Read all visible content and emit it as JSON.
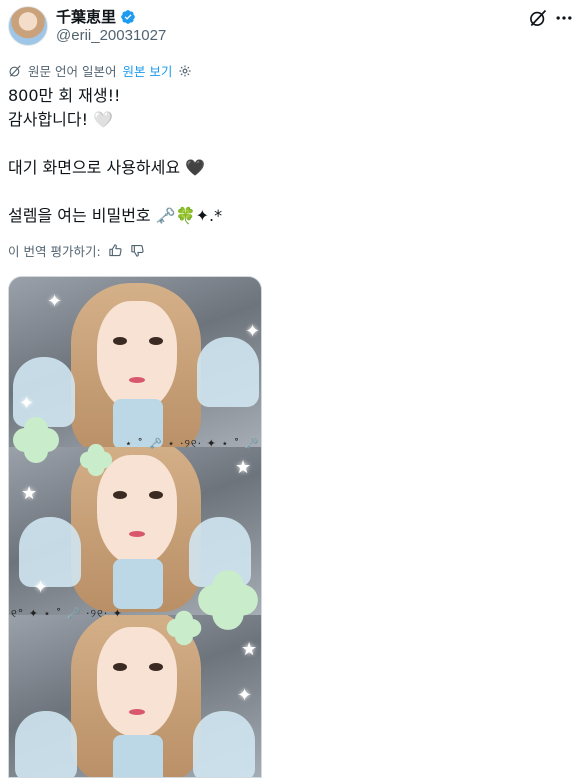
{
  "author": {
    "display_name": "千葉恵里",
    "handle": "@erii_20031027",
    "verified_icon": "verified-badge-icon",
    "accent_color": "#1d9bf0"
  },
  "header_actions": {
    "grok_icon": "grok-icon",
    "more_icon": "more-icon"
  },
  "translation": {
    "icon": "translate-icon",
    "source_label": "원문 언어 일본어",
    "show_original_label": "원본 보기",
    "settings_icon": "gear-icon"
  },
  "tweet": {
    "text": "800만 회 재생!!\n감사합니다! 🤍\n\n대기 화면으로 사용하세요 🖤\n\n설렘을 여는 비밀번호 🗝️🍀✦.*"
  },
  "rate_translation": {
    "label": "이 번역 평가하기:",
    "thumbs_up_icon": "thumbs-up-icon",
    "thumbs_down_icon": "thumbs-down-icon"
  },
  "media": {
    "decoration_line_1": "⋆ ˚ 🗝️ ⋆ ·୨୧· ✦ ⋆ ˚ 🗝️",
    "decoration_line_2": "୧° ✦ ⋆ ˚ 🗝️ ·୨୧· ✦"
  }
}
